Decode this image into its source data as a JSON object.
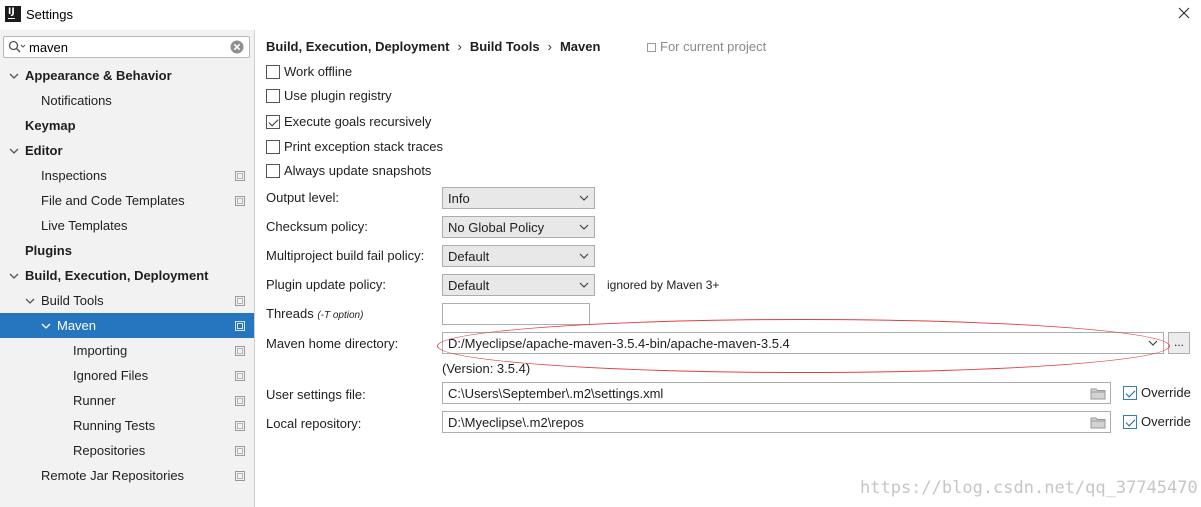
{
  "window": {
    "title": "Settings"
  },
  "search": {
    "value": "maven"
  },
  "sidebar": {
    "items": [
      {
        "label": "Appearance & Behavior"
      },
      {
        "label": "Notifications"
      },
      {
        "label": "Keymap"
      },
      {
        "label": "Editor"
      },
      {
        "label": "Inspections"
      },
      {
        "label": "File and Code Templates"
      },
      {
        "label": "Live Templates"
      },
      {
        "label": "Plugins"
      },
      {
        "label": "Build, Execution, Deployment"
      },
      {
        "label": "Build Tools"
      },
      {
        "label": "Maven"
      },
      {
        "label": "Importing"
      },
      {
        "label": "Ignored Files"
      },
      {
        "label": "Runner"
      },
      {
        "label": "Running Tests"
      },
      {
        "label": "Repositories"
      },
      {
        "label": "Remote Jar Repositories"
      }
    ]
  },
  "breadcrumb": {
    "items": [
      "Build, Execution, Deployment",
      "Build Tools",
      "Maven"
    ],
    "separator": "›",
    "scope": "For current project"
  },
  "checkboxes": [
    {
      "label": "Work offline",
      "checked": false
    },
    {
      "label": "Use plugin registry",
      "checked": false
    },
    {
      "label": "Execute goals recursively",
      "checked": true
    },
    {
      "label": "Print exception stack traces",
      "checked": false
    },
    {
      "label": "Always update snapshots",
      "checked": false
    }
  ],
  "fields": {
    "output_level": {
      "label": "Output level:",
      "value": "Info"
    },
    "checksum_policy": {
      "label": "Checksum policy:",
      "value": "No Global Policy"
    },
    "multiproject_fail": {
      "label": "Multiproject build fail policy:",
      "value": "Default"
    },
    "plugin_update": {
      "label": "Plugin update policy:",
      "value": "Default",
      "note": "ignored by Maven 3+"
    },
    "threads": {
      "label": "Threads",
      "hint": "(-T option)",
      "value": ""
    },
    "maven_home": {
      "label": "Maven home directory:",
      "value": "D:/Myeclipse/apache-maven-3.5.4-bin/apache-maven-3.5.4",
      "browse": "...",
      "version": "(Version: 3.5.4)"
    },
    "user_settings": {
      "label": "User settings file:",
      "value": "C:\\Users\\September\\.m2\\settings.xml",
      "override_label": "Override",
      "override": true
    },
    "local_repo": {
      "label": "Local repository:",
      "value": "D:\\Myeclipse\\.m2\\repos",
      "override_label": "Override",
      "override": true
    }
  },
  "watermark": "https://blog.csdn.net/qq_37745470",
  "colors": {
    "selection": "#2675bf",
    "annotation": "#e04040"
  }
}
